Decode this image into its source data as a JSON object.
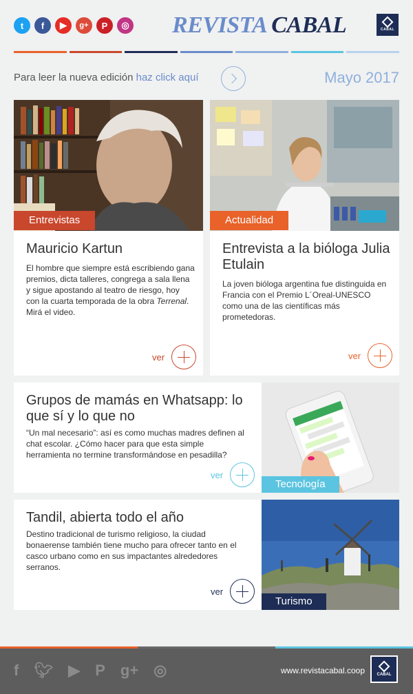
{
  "header": {
    "social": [
      "twitter-icon",
      "facebook-icon",
      "youtube-icon",
      "google-plus-icon",
      "pinterest-icon",
      "instagram-icon"
    ],
    "brand_part1": "REVISTA",
    "brand_part2": "CABAL",
    "logo_label": "CABAL"
  },
  "edition": {
    "prefix": "Para leer la nueva edición ",
    "link": "haz click aquí",
    "date": "Mayo 2017"
  },
  "articles": [
    {
      "category": "Entrevistas",
      "title": "Mauricio Kartun",
      "body_before": "El hombre que siempre está escribiendo gana premios, dicta talleres, congrega a sala llena y sigue apostando al teatro de riesgo, hoy con la cuarta temporada de la obra ",
      "body_em": "Terrenal",
      "body_after": ". Mirá el video.",
      "cta": "ver",
      "accent": "#c9472d"
    },
    {
      "category": "Actualidad",
      "title": "Entrevista a la bióloga Julia Etulain",
      "body": "La joven bióloga argentina fue distinguida en Francia con el Premio L´Oreal-UNESCO como una de las científicas más prometedoras.",
      "cta": "ver",
      "accent": "#e8622a"
    },
    {
      "category": "Tecnología",
      "title": "Grupos de mamás en Whatsapp: lo que sí y lo que no",
      "body": "“Un mal necesario”: así es como muchas madres definen al chat escolar. ¿Cómo hacer para que esta simple herramienta no termine transformándose en pesadilla?",
      "cta": "ver",
      "accent": "#5bc4e0"
    },
    {
      "category": "Turismo",
      "title": "Tandil, abierta todo el año",
      "body": "Destino tradicional de turismo religioso, la ciudad bonaerense también tiene mucho para ofrecer tanto en el casco urbano como en sus impactantes alrededores serranos.",
      "cta": "ver",
      "accent": "#1e2d55"
    }
  ],
  "footer": {
    "social": [
      "facebook-icon",
      "twitter-icon",
      "youtube-icon",
      "pinterest-icon",
      "google-plus-icon",
      "instagram-icon"
    ],
    "site": "www.revistacabal.coop",
    "logo_label": "CABAL"
  },
  "colors": {
    "stripes": [
      "#e8622a",
      "#c9472d",
      "#1e2d55",
      "#6a8ccb",
      "#8fb0de",
      "#5bc4e0",
      "#b9d3ee"
    ],
    "footer_bar": [
      "#e8622a",
      "#6a6a6a",
      "#5bc4e0"
    ]
  }
}
